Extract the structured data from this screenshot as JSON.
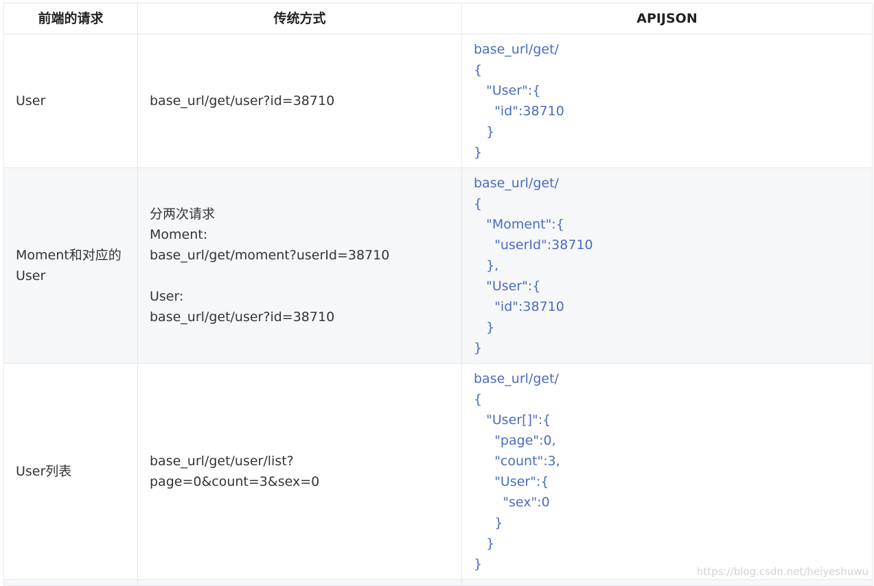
{
  "header": {
    "col1": "前端的请求",
    "col2": "传统方式",
    "col3": "APIJSON"
  },
  "rows": [
    {
      "request": [
        "User"
      ],
      "traditional": [
        "base_url/get/user?id=38710"
      ],
      "apijson": [
        "base_url/get/",
        "{",
        "   \"User\":{",
        "     \"id\":38710",
        "   }",
        "}"
      ]
    },
    {
      "request": [
        "Moment和对应的",
        "User"
      ],
      "traditional": [
        "分两次请求",
        "Moment:",
        "base_url/get/moment?userId=38710",
        "",
        "User:",
        "base_url/get/user?id=38710"
      ],
      "apijson": [
        "base_url/get/",
        "{",
        "   \"Moment\":{",
        "     \"userId\":38710",
        "   },",
        "   \"User\":{",
        "     \"id\":38710",
        "   }",
        "}"
      ]
    },
    {
      "request": [
        "User列表"
      ],
      "traditional": [
        "base_url/get/user/list?",
        "page=0&count=3&sex=0"
      ],
      "apijson": [
        "base_url/get/",
        "{",
        "   \"User[]\":{",
        "     \"page\":0,",
        "     \"count\":3,",
        "     \"User\":{",
        "       \"sex\":0",
        "     }",
        "   }",
        "}"
      ]
    }
  ],
  "watermark": "https://blog.csdn.net/heiyeshuwu",
  "colors": {
    "code_text": "#4a6bbf",
    "body_text": "#333333",
    "stripe": "#f6f7f9",
    "border": "#e4e6ea"
  }
}
